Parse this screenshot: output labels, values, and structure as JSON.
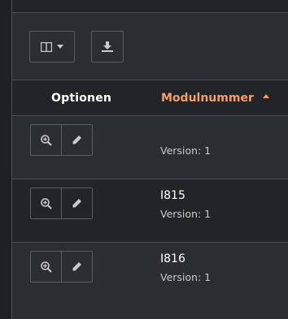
{
  "toolbar": {
    "columns_icon": "columns-icon",
    "dropdown_icon": "caret-down-icon",
    "export_icon": "download-icon"
  },
  "table": {
    "headers": {
      "options": "Optionen",
      "module_number": "Modulnummer"
    },
    "sort": {
      "column": "module_number",
      "direction": "ascending"
    },
    "rows": [
      {
        "number": "",
        "version": "Version: 1"
      },
      {
        "number": "I815",
        "version": "Version: 1"
      },
      {
        "number": "I816",
        "version": "Version: 1"
      }
    ],
    "row_action_icons": [
      "zoom-in-icon",
      "pencil-icon"
    ]
  },
  "colors": {
    "accent": "#f0a070",
    "background": "#222427",
    "panel": "#2a2d31",
    "border": "#4a4d52"
  }
}
